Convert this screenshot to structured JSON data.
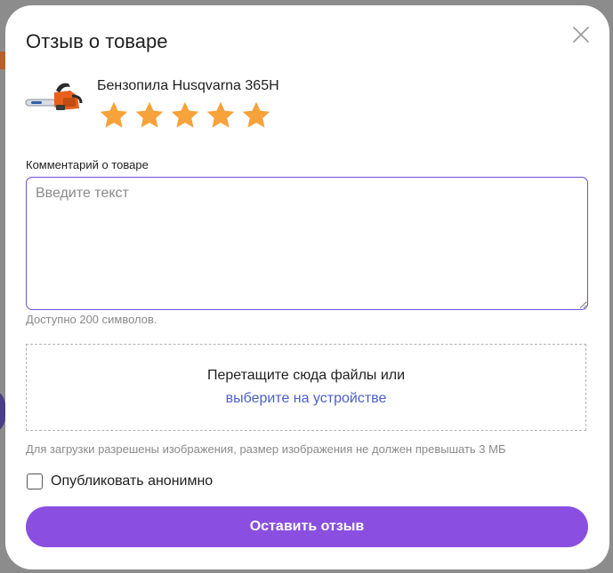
{
  "modal": {
    "title": "Отзыв о товаре",
    "close_icon": "close-icon"
  },
  "product": {
    "name": "Бензопила Husqvarna 365H",
    "image_icon": "chainsaw-image",
    "rating": 5,
    "rating_max": 5,
    "star_color": "#f7a23a"
  },
  "comment": {
    "label": "Комментарий о товаре",
    "value": "",
    "placeholder": "Введите текст",
    "hint": "Доступно 200 символов."
  },
  "upload": {
    "drop_text": "Перетащите сюда файлы или",
    "select_link": "выберите на устройстве",
    "hint": "Для загрузки разрешены изображения, размер изображения не должен превышать 3 МБ"
  },
  "anonymous": {
    "label": "Опубликовать анонимно",
    "checked": false
  },
  "submit": {
    "label": "Оставить отзыв",
    "color": "#8a4fe0"
  }
}
